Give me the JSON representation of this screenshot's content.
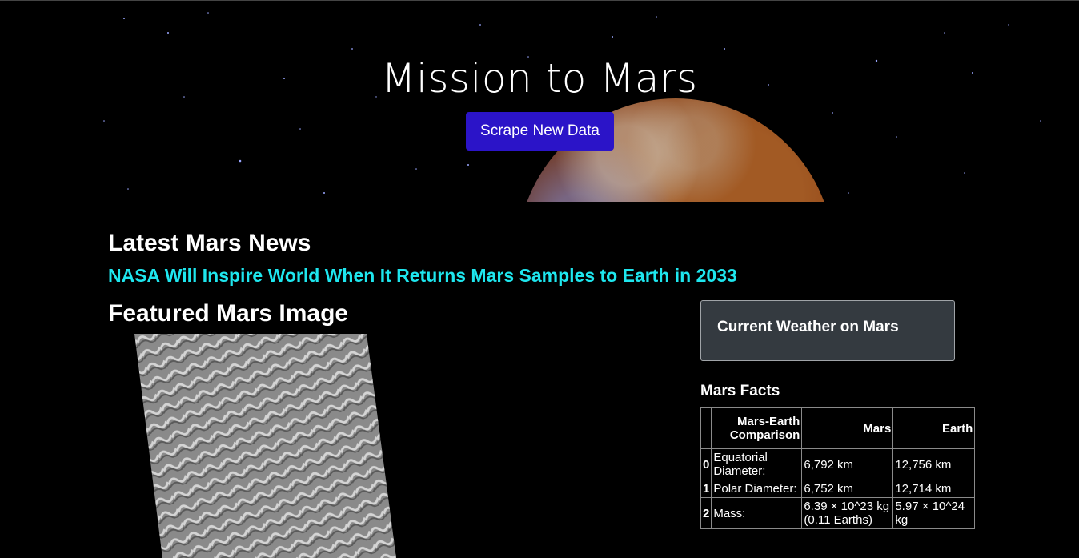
{
  "hero": {
    "title": "Mission to Mars",
    "scrape_button": "Scrape New Data"
  },
  "news": {
    "heading": "Latest Mars News",
    "headline": "NASA Will Inspire World When It Returns Mars Samples to Earth in 2033"
  },
  "featured": {
    "heading": "Featured Mars Image"
  },
  "weather": {
    "heading": "Current Weather on Mars"
  },
  "facts": {
    "heading": "Mars Facts",
    "columns": [
      "",
      "Mars-Earth Comparison",
      "Mars",
      "Earth"
    ],
    "rows": [
      {
        "index": "0",
        "label": "Equatorial Diameter:",
        "mars": "6,792 km",
        "earth": "12,756 km"
      },
      {
        "index": "1",
        "label": "Polar Diameter:",
        "mars": "6,752 km",
        "earth": "12,714 km"
      },
      {
        "index": "2",
        "label": "Mass:",
        "mars": "6.39 × 10^23 kg (0.11 Earths)",
        "earth": "5.97 × 10^24 kg"
      }
    ]
  },
  "colors": {
    "background": "#000000",
    "button": "#2b14c8",
    "news_link": "#1ee6ee",
    "weather_card": "#343a40"
  }
}
